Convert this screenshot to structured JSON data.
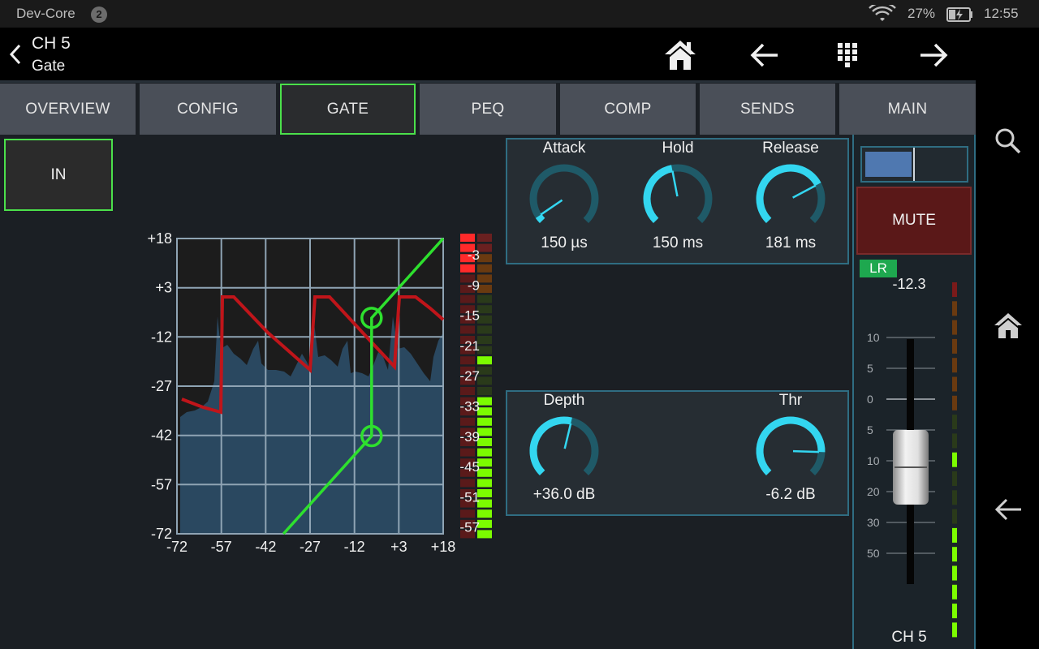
{
  "status_bar": {
    "app_name": "Dev-Core",
    "notification_count": "2",
    "battery": "27%",
    "time": "12:55"
  },
  "header": {
    "channel": "CH 5",
    "page": "Gate",
    "icons": [
      "home-icon",
      "arrow-left-icon",
      "grid-icon",
      "arrow-right-icon"
    ]
  },
  "tabs": [
    {
      "label": "OVERVIEW",
      "active": false
    },
    {
      "label": "CONFIG",
      "active": false
    },
    {
      "label": "GATE",
      "active": true
    },
    {
      "label": "PEQ",
      "active": false
    },
    {
      "label": "COMP",
      "active": false
    },
    {
      "label": "SENDS",
      "active": false
    },
    {
      "label": "MAIN",
      "active": false
    }
  ],
  "gate": {
    "in_label": "IN",
    "graph": {
      "y_ticks": [
        "+18",
        "+3",
        "-12",
        "-27",
        "-42",
        "-57",
        "-72"
      ],
      "x_ticks": [
        "-72",
        "-57",
        "-42",
        "-27",
        "-12",
        "+3",
        "+18"
      ],
      "meter_ticks": [
        "-3",
        "-9",
        "-15",
        "-21",
        "-27",
        "-33",
        "-39",
        "-45",
        "-51",
        "-57"
      ],
      "threshold_db": -6.2,
      "depth_db": 36.0
    },
    "knobs_top": [
      {
        "label": "Attack",
        "value": "150 µs",
        "fraction": 0.04
      },
      {
        "label": "Hold",
        "value": "150 ms",
        "fraction": 0.46
      },
      {
        "label": "Release",
        "value": "181 ms",
        "fraction": 0.73
      }
    ],
    "knobs_bottom": [
      {
        "label": "Depth",
        "value": "+36.0 dB",
        "fraction": 0.55
      },
      {
        "label": "Thr",
        "value": "-6.2 dB",
        "fraction": 0.84
      }
    ]
  },
  "strip": {
    "mute_label": "MUTE",
    "bus_label": "LR",
    "fader_db": "-12.3",
    "scale": [
      "10",
      "5",
      "0",
      "5",
      "10",
      "20",
      "30",
      "50"
    ],
    "name": "CH 5",
    "pan_fraction": 0.5
  },
  "colors": {
    "accent_green": "#4be04b",
    "panel_border": "#2f6d82",
    "knob_arc": "#33d6f0",
    "mute_red": "#5a1818",
    "curve_red": "#d01818",
    "signal_fill": "#2a4860"
  },
  "system_nav": [
    "search-icon",
    "home-icon",
    "back-icon"
  ]
}
